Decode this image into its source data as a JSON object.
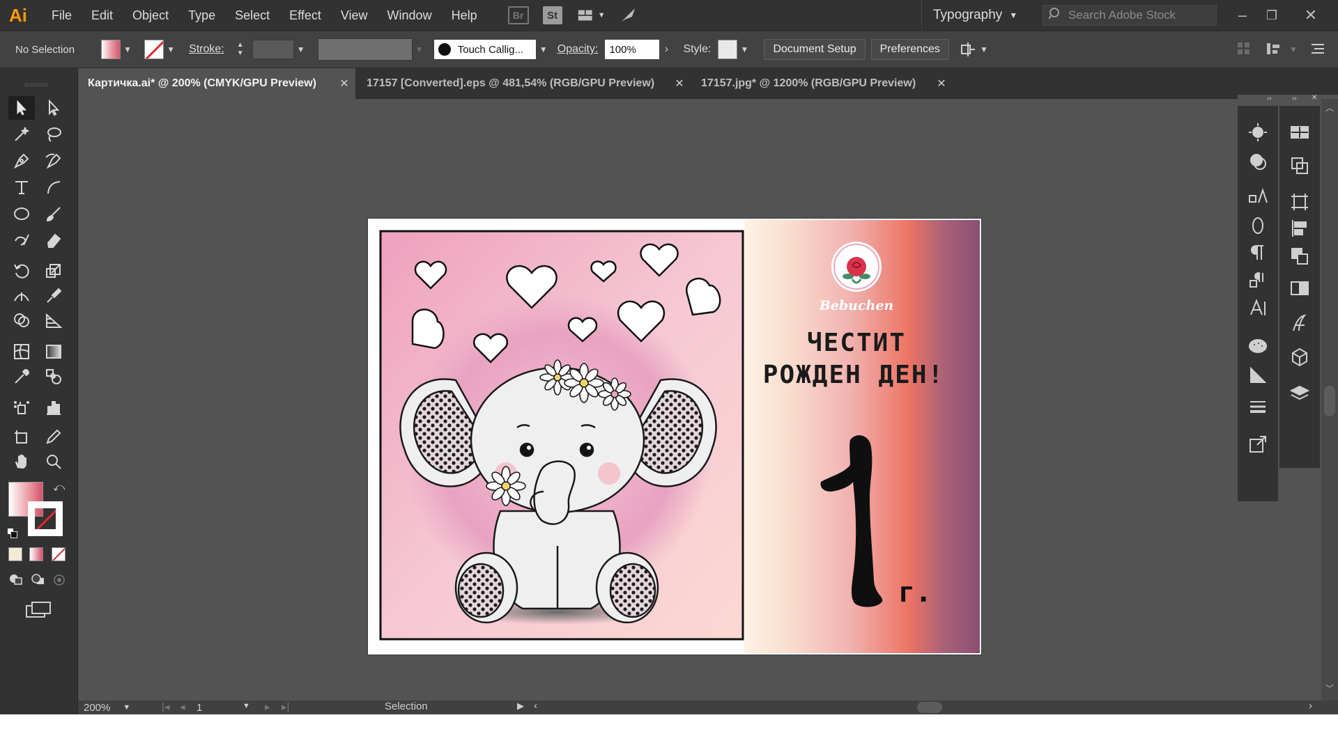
{
  "app": {
    "logo": "Ai",
    "menu": [
      "File",
      "Edit",
      "Object",
      "Type",
      "Select",
      "Effect",
      "View",
      "Window",
      "Help"
    ],
    "bridge_label": "Br",
    "stock_label": "St",
    "workspace": "Typography",
    "search_placeholder": "Search Adobe Stock"
  },
  "control_bar": {
    "selection_status": "No Selection",
    "stroke_label": "Stroke:",
    "brush": "Touch Callig...",
    "opacity_label": "Opacity:",
    "opacity_value": "100%",
    "style_label": "Style:",
    "document_setup_label": "Document Setup",
    "preferences_label": "Preferences"
  },
  "tabs": [
    {
      "label": "Картичка.ai* @ 200% (CMYK/GPU Preview)",
      "active": true
    },
    {
      "label": "17157 [Converted].eps @ 481,54% (RGB/GPU Preview)",
      "active": false
    },
    {
      "label": "17157.jpg* @ 1200% (RGB/GPU Preview)",
      "active": false
    }
  ],
  "artwork": {
    "brand": "Bebuchen",
    "greeting_line1": "ЧЕСТИТ",
    "greeting_line2": "РОЖДЕН ДЕН!",
    "age_suffix": "г.",
    "colors": {
      "accent_pink": "#e7a9c0",
      "gradient_coral": "#ef7a6a",
      "gradient_plum": "#8a4f73"
    }
  },
  "status_bar": {
    "zoom": "200%",
    "artboard_number": "1",
    "current_tool": "Selection"
  }
}
